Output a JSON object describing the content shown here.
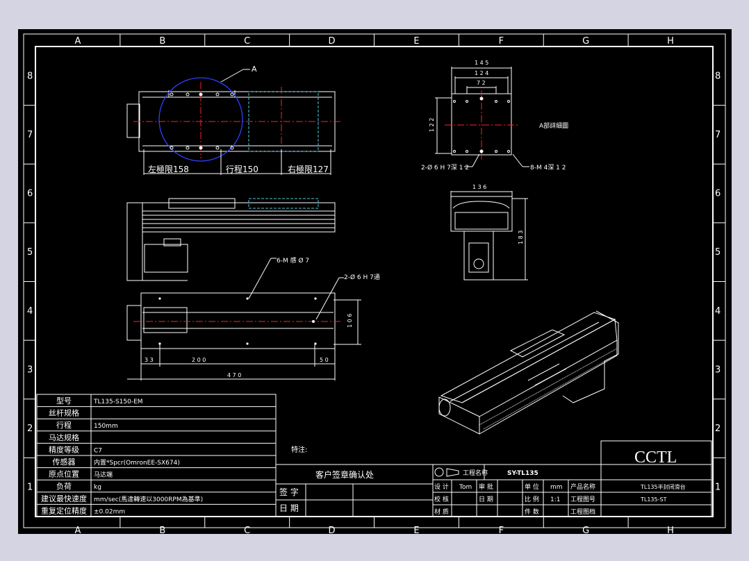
{
  "colors": {
    "window_bg": "#d4d4e2",
    "sheet_bg": "#000000",
    "line": "#ffffff",
    "centerline": "#ff2020",
    "hidden": "#50c8d8",
    "circle": "#3040ff"
  },
  "border": {
    "columns": [
      "A",
      "B",
      "C",
      "D",
      "E",
      "F",
      "G",
      "H"
    ],
    "rows": [
      "8",
      "7",
      "6",
      "5",
      "4",
      "3",
      "2",
      "1"
    ]
  },
  "top_view": {
    "callout": "A",
    "left_limit": "左極限158",
    "stroke": "行程150",
    "right_limit": "右極限127"
  },
  "bottom_view": {
    "note_holes": "6-M 感 Ø 7",
    "note_pin": "2-Ø 6 H 7通",
    "dim_height": "1 0 6",
    "dim_left": "3 3",
    "dim_pitch": "2 0 0",
    "dim_right": "5 0",
    "dim_total": "4 7 0"
  },
  "detail_view": {
    "dim_145": "1 4 5",
    "dim_124": "1 2 4",
    "dim_72": "7 2",
    "dim_122": "1 2 2",
    "label": "A部詳細圖",
    "pin_note": "2-Ø 6 H 7深 1 2",
    "thread_note": "8-M 4深 1 2"
  },
  "end_view": {
    "dim_width": "1 3 6",
    "dim_height": "1 8 3"
  },
  "spec_table": [
    {
      "label": "型号",
      "value": "TL135-S150-EM"
    },
    {
      "label": "丝杆规格",
      "value": ""
    },
    {
      "label": "行程",
      "value": "150mm"
    },
    {
      "label": "马达规格",
      "value": ""
    },
    {
      "label": "精度等级",
      "value": "C7"
    },
    {
      "label": "传感器",
      "value": "内置*Spcr(OmronEE-SX674)"
    },
    {
      "label": "原点位置",
      "value": "马达端"
    },
    {
      "label": "负荷",
      "value": "kg"
    },
    {
      "label": "建议最快速度",
      "value": "mm/sec(馬達轉速以3000RPM為基準)"
    },
    {
      "label": "重复定位精度",
      "value": "±0.02mm"
    }
  ],
  "notes_label": "特注:",
  "sign_box": {
    "title": "客户签章确认处",
    "sign_label": "签 字",
    "date_label": "日 期"
  },
  "title_block": {
    "logo": "CCTL",
    "project_name_label": "工程名称",
    "drawing_code": "SY-TL135",
    "rows": [
      {
        "a": "设 计",
        "b": "Tom",
        "c": "审 批",
        "d": "单 位",
        "e": "mm",
        "f": "产品名称",
        "g": "TL135半封闭滑台"
      },
      {
        "a": "校 核",
        "b": "",
        "c": "日 期",
        "d": "比 例",
        "e": "1:1",
        "f": "工程图号",
        "g": "TL135-ST"
      },
      {
        "a": "材 质",
        "b": "",
        "c": "",
        "d": "件 数",
        "e": "",
        "f": "工程图档",
        "g": ""
      }
    ]
  }
}
